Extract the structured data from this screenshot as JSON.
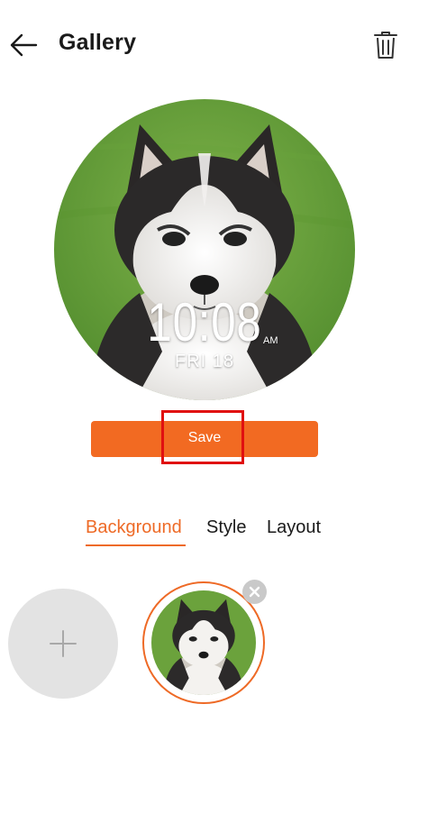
{
  "header": {
    "title": "Gallery",
    "back_icon": "arrow-left-icon",
    "delete_icon": "trash-icon"
  },
  "watch_face": {
    "time": "10:08",
    "ampm": "AM",
    "date": "FRI 18",
    "background": "husky-puppy-photo"
  },
  "actions": {
    "save_label": "Save"
  },
  "tabs": [
    {
      "label": "Background",
      "active": true
    },
    {
      "label": "Style",
      "active": false
    },
    {
      "label": "Layout",
      "active": false
    }
  ],
  "backgrounds": {
    "add_icon": "plus-icon",
    "remove_icon": "close-icon",
    "items": [
      {
        "image": "husky-puppy-photo",
        "selected": true
      }
    ]
  },
  "colors": {
    "accent": "#ee6a26",
    "save_button": "#f26a22",
    "highlight": "#e01010"
  }
}
